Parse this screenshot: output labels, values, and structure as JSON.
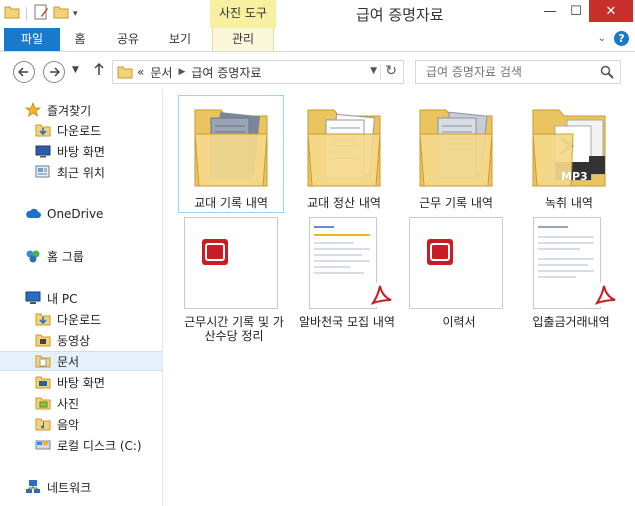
{
  "window": {
    "title": "급여 증명자료",
    "context_tab": "사진 도구",
    "controls": {
      "minimize": "—",
      "maximize": "☐",
      "close": "✕"
    }
  },
  "ribbon": {
    "tabs": [
      "파일",
      "홈",
      "공유",
      "보기",
      "관리"
    ],
    "help": "?"
  },
  "address": {
    "overflow": "«",
    "path": [
      "문서",
      "급여 증명자료"
    ]
  },
  "search": {
    "placeholder": "급여 증명자료 검색"
  },
  "nav": {
    "favorites": {
      "label": "즐겨찾기",
      "items": [
        "다운로드",
        "바탕 화면",
        "최근 위치"
      ]
    },
    "onedrive": "OneDrive",
    "homegroup": "홈 그룹",
    "thispc": {
      "label": "내 PC",
      "items": [
        "다운로드",
        "동영상",
        "문서",
        "바탕 화면",
        "사진",
        "음악",
        "로컬 디스크 (C:)"
      ]
    },
    "network": "네트워크"
  },
  "files": [
    {
      "name": "교대 기록 내역",
      "type": "folder"
    },
    {
      "name": "교대 정산 내역",
      "type": "folder"
    },
    {
      "name": "근무 기록 내역",
      "type": "folder"
    },
    {
      "name": "녹취 내역",
      "type": "folder-mp3"
    },
    {
      "name": "근무시간 기록 및 가산수당 정리",
      "type": "pdf"
    },
    {
      "name": "알바천국 모집 내역",
      "type": "pdf-preview"
    },
    {
      "name": "이력서",
      "type": "pdf"
    },
    {
      "name": "입출금거래내역",
      "type": "pdf-preview"
    }
  ],
  "mp3_label": "MP3",
  "colors": {
    "accent": "#1979ca",
    "close": "#c7302b",
    "context": "#f6f0a0",
    "folder": "#f3d27a",
    "pdf": "#c81d25"
  }
}
